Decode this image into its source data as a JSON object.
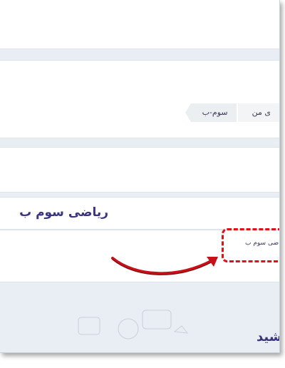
{
  "breadcrumb": {
    "current": "سوم-ب",
    "parent": "ی من"
  },
  "page": {
    "title": "ریاضی سوم ب"
  },
  "list": {
    "items": [
      {
        "label": "ریاضی سوم ب"
      }
    ]
  },
  "footer": {
    "text": "شید"
  },
  "colors": {
    "accent": "#3a3481",
    "highlight": "#e0101a"
  }
}
